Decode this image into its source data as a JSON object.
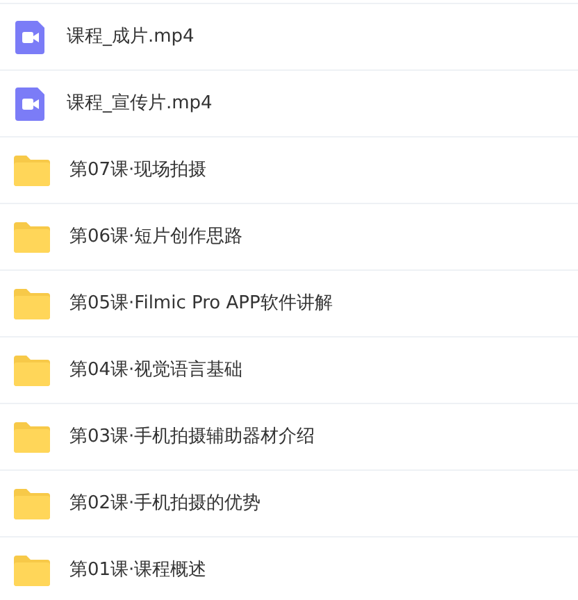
{
  "files": [
    {
      "kind": "video",
      "name": "课程_成片.mp4"
    },
    {
      "kind": "video",
      "name": "课程_宣传片.mp4"
    },
    {
      "kind": "folder",
      "name": "第07课·现场拍摄"
    },
    {
      "kind": "folder",
      "name": "第06课·短片创作思路"
    },
    {
      "kind": "folder",
      "name": "第05课·Filmic Pro APP软件讲解"
    },
    {
      "kind": "folder",
      "name": "第04课·视觉语言基础"
    },
    {
      "kind": "folder",
      "name": "第03课·手机拍摄辅助器材介绍"
    },
    {
      "kind": "folder",
      "name": "第02课·手机拍摄的优势"
    },
    {
      "kind": "folder",
      "name": "第01课·课程概述"
    }
  ]
}
